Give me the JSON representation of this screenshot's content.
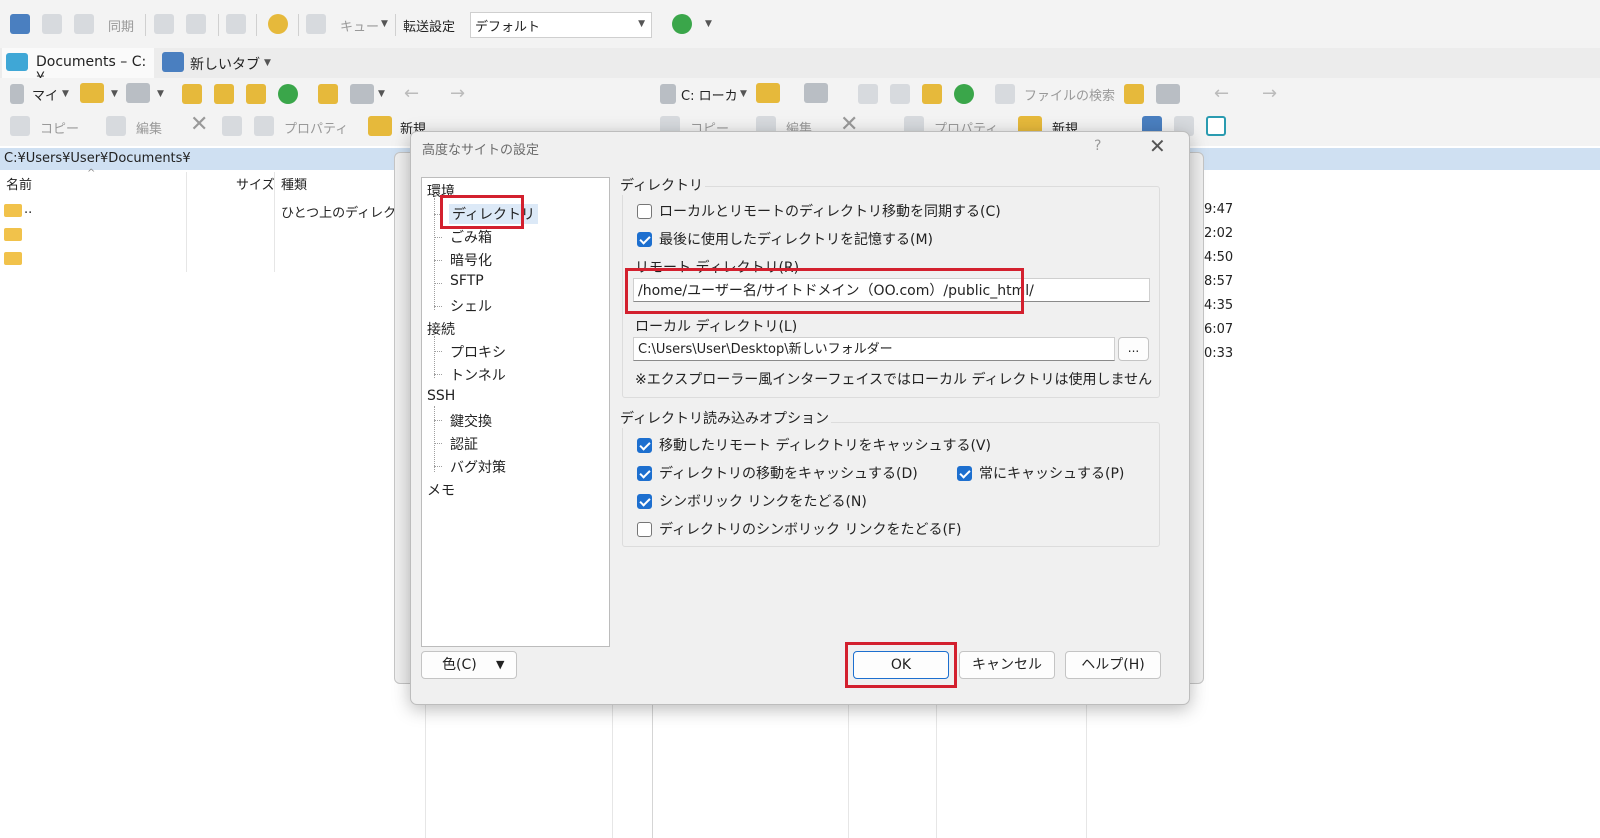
{
  "toolbar1": {
    "sync_label": "同期",
    "queue_label": "キュー",
    "transfer_label": "転送設定",
    "transfer_value": "デフォルト"
  },
  "tabs": [
    {
      "label": "Documents – C:¥"
    },
    {
      "label": "新しいタブ"
    }
  ],
  "toolbar_nav": {
    "left_location": "マイ",
    "right_location": "C: ローカ",
    "find_files_label": "ファイルの検索"
  },
  "toolbar_files": {
    "copy_label": "コピー",
    "edit_label": "編集",
    "properties_label": "プロパティ",
    "new_label": "新規"
  },
  "left_panel": {
    "path": "C:¥Users¥User¥Documents¥",
    "columns": [
      "名前",
      "サイズ",
      "種類"
    ],
    "rows": [
      {
        "name": "..",
        "type": "ひとつ上のディレクト"
      }
    ]
  },
  "right_panel": {
    "times": [
      "9:47",
      "2:02",
      "4:50",
      "8:57",
      "4:35",
      "6:07",
      "0:33"
    ]
  },
  "dialog": {
    "title": "高度なサイトの設定",
    "help_glyph": "?",
    "close_glyph": "✕",
    "tree": [
      {
        "label": "環境"
      },
      {
        "label": "ディレクトリ"
      },
      {
        "label": "ごみ箱"
      },
      {
        "label": "暗号化"
      },
      {
        "label": "SFTP"
      },
      {
        "label": "シェル"
      },
      {
        "label": "接続"
      },
      {
        "label": "プロキシ"
      },
      {
        "label": "トンネル"
      },
      {
        "label": "SSH"
      },
      {
        "label": "鍵交換"
      },
      {
        "label": "認証"
      },
      {
        "label": "バグ対策"
      },
      {
        "label": "メモ"
      }
    ],
    "directories": {
      "group_label": "ディレクトリ",
      "sync_browsing": {
        "label": "ローカルとリモートのディレクトリ移動を同期する(C)",
        "checked": false
      },
      "remember_last": {
        "label": "最後に使用したディレクトリを記憶する(M)",
        "checked": true
      },
      "remote_label": "リモート ディレクトリ(R)",
      "remote_value": "/home/ユーザー名/サイトドメイン（OO.com）/public_html/",
      "local_label": "ローカル ディレクトリ(L)",
      "local_value": "C:\\Users\\User\\Desktop\\新しいフォルダー",
      "browse_label": "...",
      "note": "※エクスプローラー風インターフェイスではローカル ディレクトリは使用しません"
    },
    "reading": {
      "group_label": "ディレクトリ読み込みオプション",
      "cache_visited": {
        "label": "移動したリモート ディレクトリをキャッシュする(V)",
        "checked": true
      },
      "cache_changes": {
        "label": "ディレクトリの移動をキャッシュする(D)",
        "checked": true
      },
      "always_cache": {
        "label": "常にキャッシュする(P)",
        "checked": true
      },
      "resolve_symlinks": {
        "label": "シンボリック リンクをたどる(N)",
        "checked": true
      },
      "follow_dir_symlinks": {
        "label": "ディレクトリのシンボリック リンクをたどる(F)",
        "checked": false
      }
    },
    "buttons": {
      "color": "色(C)",
      "ok": "OK",
      "cancel": "キャンセル",
      "help": "ヘルプ(H)"
    }
  },
  "colors": {
    "highlight_red": "#d3202e",
    "check_blue": "#1d6fcf",
    "path_bar": "#cfe0f2"
  }
}
